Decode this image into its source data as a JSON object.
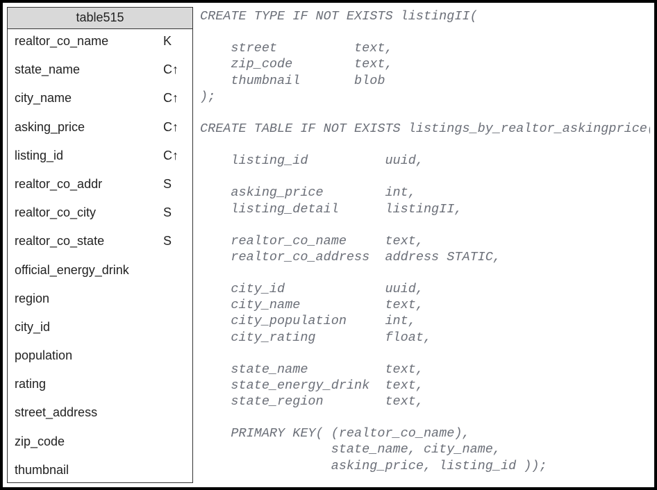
{
  "schema_table": {
    "title": "table515",
    "columns": [
      {
        "name": "realtor_co_name",
        "mark": "K"
      },
      {
        "name": "state_name",
        "mark": "C↑"
      },
      {
        "name": "city_name",
        "mark": "C↑"
      },
      {
        "name": "asking_price",
        "mark": "C↑"
      },
      {
        "name": "listing_id",
        "mark": "C↑"
      },
      {
        "name": "realtor_co_addr",
        "mark": "S"
      },
      {
        "name": "realtor_co_city",
        "mark": "S"
      },
      {
        "name": "realtor_co_state",
        "mark": "S"
      },
      {
        "name": "official_energy_drink",
        "mark": ""
      },
      {
        "name": "region",
        "mark": ""
      },
      {
        "name": "city_id",
        "mark": ""
      },
      {
        "name": "population",
        "mark": ""
      },
      {
        "name": "rating",
        "mark": ""
      },
      {
        "name": "street_address",
        "mark": ""
      },
      {
        "name": "zip_code",
        "mark": ""
      },
      {
        "name": "thumbnail",
        "mark": ""
      }
    ]
  },
  "code": "CREATE TYPE IF NOT EXISTS listingII(\n\n    street          text,\n    zip_code        text,\n    thumbnail       blob\n);\n\nCREATE TABLE IF NOT EXISTS listings_by_realtor_askingprice(\n\n    listing_id          uuid,\n\n    asking_price        int,\n    listing_detail      listingII,\n\n    realtor_co_name     text,\n    realtor_co_address  address STATIC,\n\n    city_id             uuid,\n    city_name           text,\n    city_population     int,\n    city_rating         float,\n\n    state_name          text,\n    state_energy_drink  text,\n    state_region        text,\n\n    PRIMARY KEY( (realtor_co_name),\n                 state_name, city_name,\n                 asking_price, listing_id ));"
}
